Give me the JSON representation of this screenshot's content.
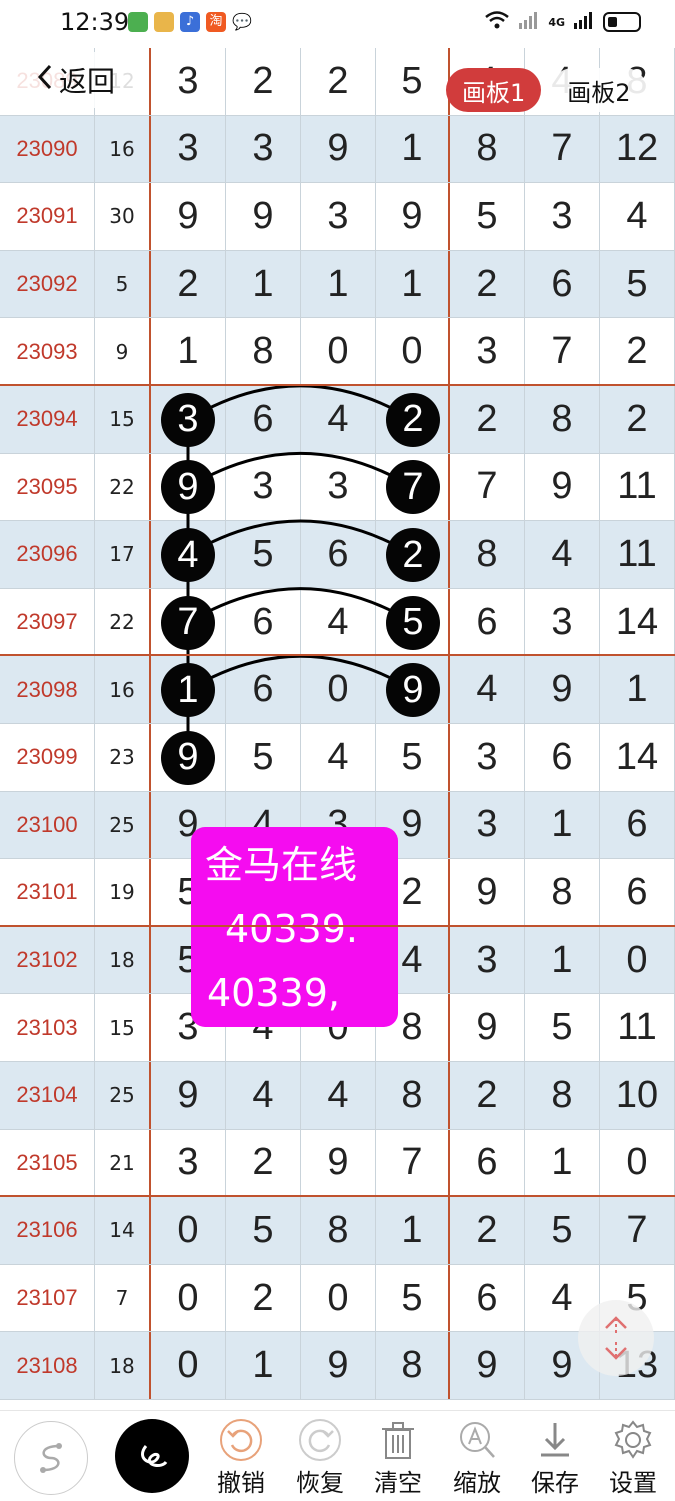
{
  "status_bar": {
    "time": "12:39",
    "network": "4G"
  },
  "nav": {
    "back_label": "返回",
    "tabs": [
      {
        "label": "画板1",
        "active": true
      },
      {
        "label": "画板2",
        "active": false
      }
    ]
  },
  "rows": [
    {
      "id": "23089",
      "sum": "12",
      "d": [
        "3",
        "2",
        "2",
        "5"
      ],
      "r": [
        "4",
        "4",
        "8"
      ]
    },
    {
      "id": "23090",
      "sum": "16",
      "d": [
        "3",
        "3",
        "9",
        "1"
      ],
      "r": [
        "8",
        "7",
        "12"
      ]
    },
    {
      "id": "23091",
      "sum": "30",
      "d": [
        "9",
        "9",
        "3",
        "9"
      ],
      "r": [
        "5",
        "3",
        "4"
      ]
    },
    {
      "id": "23092",
      "sum": "5",
      "d": [
        "2",
        "1",
        "1",
        "1"
      ],
      "r": [
        "2",
        "6",
        "5"
      ]
    },
    {
      "id": "23093",
      "sum": "9",
      "d": [
        "1",
        "8",
        "0",
        "0"
      ],
      "r": [
        "3",
        "7",
        "2"
      ]
    },
    {
      "id": "23094",
      "sum": "15",
      "d": [
        "3",
        "6",
        "4",
        "2"
      ],
      "r": [
        "2",
        "8",
        "2"
      ]
    },
    {
      "id": "23095",
      "sum": "22",
      "d": [
        "9",
        "3",
        "3",
        "7"
      ],
      "r": [
        "7",
        "9",
        "11"
      ]
    },
    {
      "id": "23096",
      "sum": "17",
      "d": [
        "4",
        "5",
        "6",
        "2"
      ],
      "r": [
        "8",
        "4",
        "11"
      ]
    },
    {
      "id": "23097",
      "sum": "22",
      "d": [
        "7",
        "6",
        "4",
        "5"
      ],
      "r": [
        "6",
        "3",
        "14"
      ]
    },
    {
      "id": "23098",
      "sum": "16",
      "d": [
        "1",
        "6",
        "0",
        "9"
      ],
      "r": [
        "4",
        "9",
        "1"
      ]
    },
    {
      "id": "23099",
      "sum": "23",
      "d": [
        "9",
        "5",
        "4",
        "5"
      ],
      "r": [
        "3",
        "6",
        "14"
      ]
    },
    {
      "id": "23100",
      "sum": "25",
      "d": [
        "9",
        "4",
        "3",
        "9"
      ],
      "r": [
        "3",
        "1",
        "6"
      ]
    },
    {
      "id": "23101",
      "sum": "19",
      "d": [
        "5",
        "",
        "",
        "2"
      ],
      "r": [
        "9",
        "8",
        "6"
      ]
    },
    {
      "id": "23102",
      "sum": "18",
      "d": [
        "5",
        "",
        "",
        "4"
      ],
      "r": [
        "3",
        "1",
        "0"
      ]
    },
    {
      "id": "23103",
      "sum": "15",
      "d": [
        "3",
        "4",
        "0",
        "8"
      ],
      "r": [
        "9",
        "5",
        "11"
      ]
    },
    {
      "id": "23104",
      "sum": "25",
      "d": [
        "9",
        "4",
        "4",
        "8"
      ],
      "r": [
        "2",
        "8",
        "10"
      ]
    },
    {
      "id": "23105",
      "sum": "21",
      "d": [
        "3",
        "2",
        "9",
        "7"
      ],
      "r": [
        "6",
        "1",
        "0"
      ]
    },
    {
      "id": "23106",
      "sum": "14",
      "d": [
        "0",
        "5",
        "8",
        "1"
      ],
      "r": [
        "2",
        "5",
        "7"
      ]
    },
    {
      "id": "23107",
      "sum": "7",
      "d": [
        "0",
        "2",
        "0",
        "5"
      ],
      "r": [
        "6",
        "4",
        "5"
      ]
    },
    {
      "id": "23108",
      "sum": "18",
      "d": [
        "0",
        "1",
        "9",
        "8"
      ],
      "r": [
        "9",
        "9",
        "13"
      ]
    }
  ],
  "marked": [
    {
      "left": "3",
      "right": "2"
    },
    {
      "left": "9",
      "right": "7"
    },
    {
      "left": "4",
      "right": "2"
    },
    {
      "left": "7",
      "right": "5"
    },
    {
      "left": "1",
      "right": "9"
    },
    {
      "left": "9",
      "right": ""
    }
  ],
  "overlay": {
    "lines": [
      "金马在线",
      "40339.",
      "40339,"
    ],
    "color": "#f50cf0"
  },
  "toolbar": {
    "items": [
      {
        "icon": "pen-curve-icon",
        "label": ""
      },
      {
        "icon": "draw-curve-icon",
        "label": ""
      },
      {
        "icon": "undo-icon",
        "label": "撤销"
      },
      {
        "icon": "redo-icon",
        "label": "恢复"
      },
      {
        "icon": "trash-icon",
        "label": "清空"
      },
      {
        "icon": "zoom-icon",
        "label": "缩放"
      },
      {
        "icon": "download-icon",
        "label": "保存"
      },
      {
        "icon": "gear-icon",
        "label": "设置"
      }
    ]
  },
  "colors": {
    "accent": "#d13c3c",
    "row_tint": "#dce8f1",
    "separator": "#c0522e",
    "id_text": "#c0392b"
  }
}
